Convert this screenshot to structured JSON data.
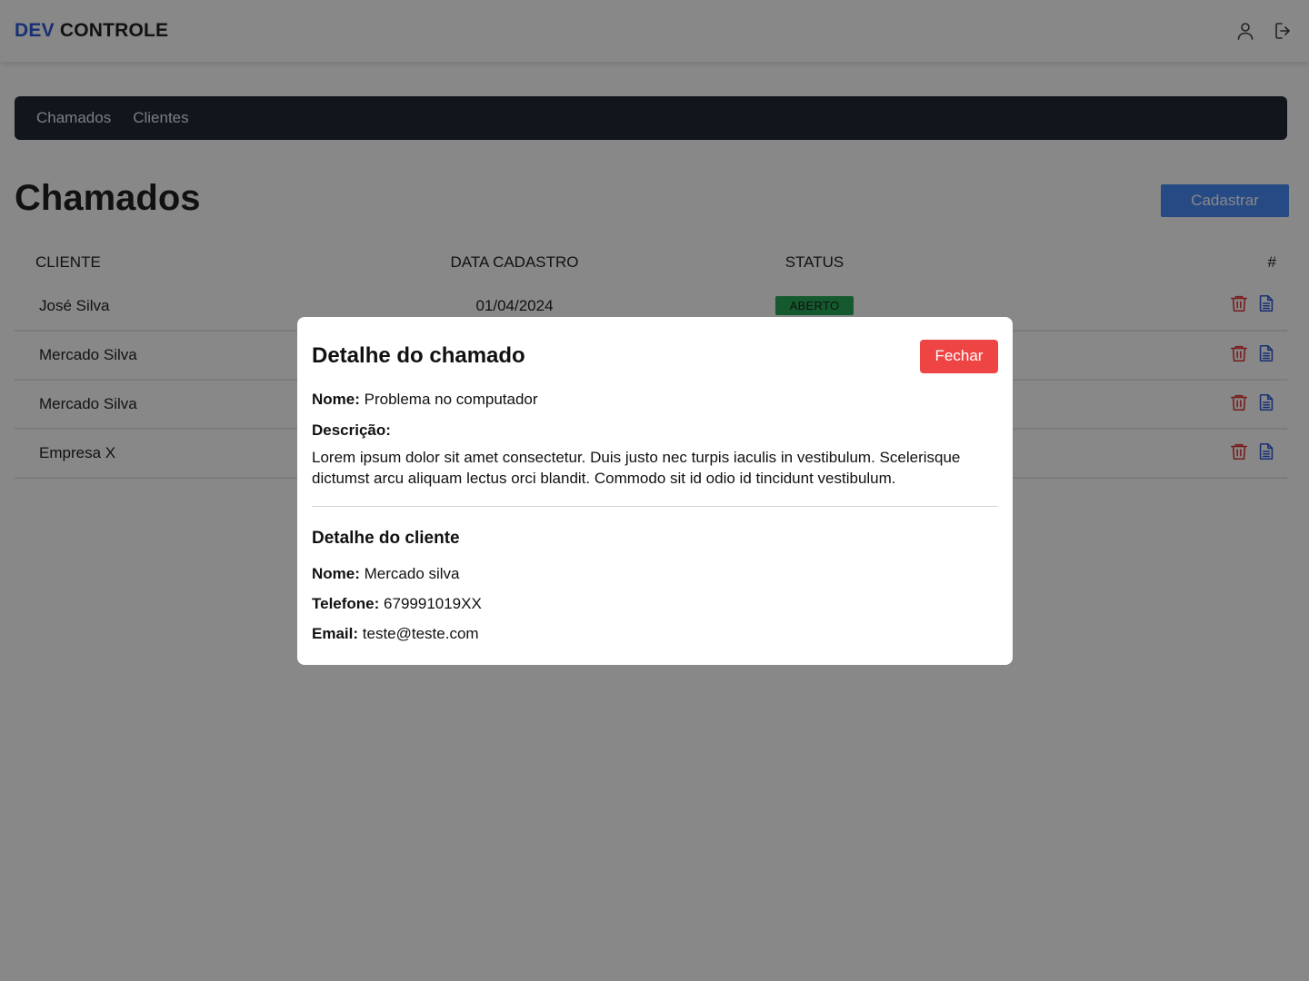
{
  "header": {
    "brand_accent": "DEV",
    "brand_main": "CONTROLE",
    "icons": [
      "user-icon",
      "logout-icon"
    ]
  },
  "nav": {
    "items": [
      {
        "label": "Chamados"
      },
      {
        "label": "Clientes"
      }
    ]
  },
  "page": {
    "title": "Chamados",
    "create_button": "Cadastrar"
  },
  "table": {
    "headers": [
      "CLIENTE",
      "DATA CADASTRO",
      "STATUS",
      "#"
    ],
    "rows": [
      {
        "client": "José Silva",
        "date": "01/04/2024",
        "status": "ABERTO"
      },
      {
        "client": "Mercado Silva",
        "date": "",
        "status": ""
      },
      {
        "client": "Mercado Silva",
        "date": "",
        "status": ""
      },
      {
        "client": "Empresa X",
        "date": "",
        "status": ""
      }
    ]
  },
  "modal": {
    "title": "Detalhe do chamado",
    "close_button": "Fechar",
    "ticket": {
      "name_label": "Nome:",
      "name_value": "Problema no computador",
      "description_label": "Descrição:",
      "description_value": "Lorem ipsum dolor sit amet consectetur. Duis justo nec turpis iaculis in vestibulum. Scelerisque dictumst arcu aliquam lectus orci blandit. Commodo sit id odio id tincidunt vestibulum."
    },
    "client": {
      "title": "Detalhe do cliente",
      "name_label": "Nome:",
      "name_value": "Mercado silva",
      "phone_label": "Telefone:",
      "phone_value": "679991019XX",
      "email_label": "Email:",
      "email_value": "teste@teste.com"
    }
  },
  "colors": {
    "brand_accent": "#1d4ed8",
    "nav_bg": "#111827",
    "primary_button": "#3b82f6",
    "status_open": "#16a34a",
    "danger": "#ef4444",
    "delete_icon": "#dc2626",
    "doc_icon": "#1d4ed8"
  }
}
